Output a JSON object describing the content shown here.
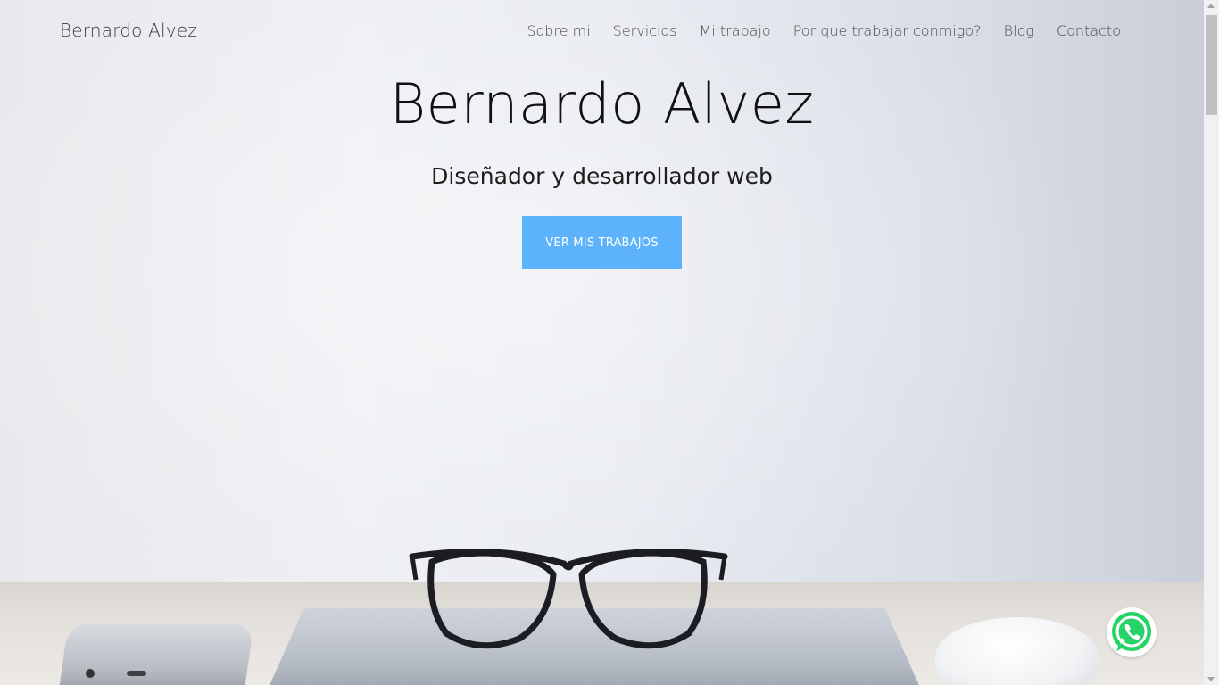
{
  "nav": {
    "brand": "Bernardo Alvez",
    "links": [
      {
        "label": "Sobre mi"
      },
      {
        "label": "Servicios"
      },
      {
        "label": "Mi trabajo"
      },
      {
        "label": "Por que trabajar conmigo?"
      },
      {
        "label": "Blog"
      },
      {
        "label": "Contacto"
      }
    ]
  },
  "hero": {
    "title": "Bernardo Alvez",
    "subtitle": "Diseñador y desarrollador web",
    "cta_label": "VER MIS TRABAJOS"
  },
  "colors": {
    "accent": "#5cb3fb",
    "whatsapp": "#25d366"
  },
  "icons": {
    "floating_contact": "whatsapp-icon"
  }
}
